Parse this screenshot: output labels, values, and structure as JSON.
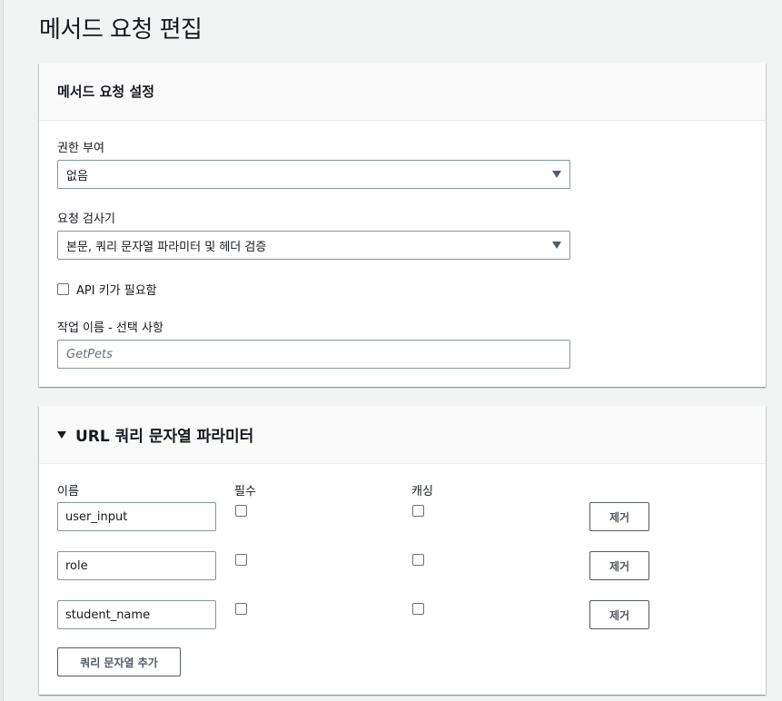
{
  "page": {
    "title": "메서드 요청 편집"
  },
  "settings": {
    "title": "메서드 요청 설정",
    "authorization": {
      "label": "권한 부여",
      "value": "없음"
    },
    "validator": {
      "label": "요청 검사기",
      "value": "본문, 쿼리 문자열 파라미터 및 헤더 검증"
    },
    "api_key": {
      "label": "API 키가 필요함",
      "checked": false
    },
    "operation_name": {
      "label": "작업 이름 - 선택 사항",
      "value": "",
      "placeholder": "GetPets"
    }
  },
  "query": {
    "title": "URL 쿼리 문자열 파라미터",
    "columns": {
      "name": "이름",
      "required": "필수",
      "caching": "캐싱"
    },
    "rows": [
      {
        "name": "user_input",
        "required": false,
        "caching": false,
        "remove_label": "제거"
      },
      {
        "name": "role",
        "required": false,
        "caching": false,
        "remove_label": "제거"
      },
      {
        "name": "student_name",
        "required": false,
        "caching": false,
        "remove_label": "제거"
      }
    ],
    "add_label": "쿼리 문자열 추가"
  },
  "colors": {
    "background": "#f2f3f3",
    "panel": "#ffffff",
    "panel_header": "#fafafa",
    "border": "#879596",
    "text": "#16191f",
    "button_text": "#545b64"
  },
  "icons": {
    "select_arrow": "caret-down-icon",
    "collapse": "caret-down-icon"
  }
}
